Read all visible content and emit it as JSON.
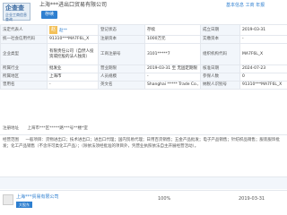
{
  "header": {
    "logo_title": "企查查",
    "logo_sub": "企业工商信息查询",
    "company_name": "上海***进出口贸易有限公司",
    "tag": "存续",
    "right_text": "基本信息 工商 年报"
  },
  "info": {
    "rows": [
      [
        "法定代表人",
        "赵**",
        "登记状态",
        "存续",
        "成立日期",
        "2019-03-31"
      ],
      [
        "统一社会信用代码",
        "91310***MA7F6L_X",
        "注册资本",
        "1000万元",
        "实缴资本",
        "-"
      ],
      [
        "企业类型",
        "有限责任公司（自然人投资或控股的法人独资）",
        "工商注册号",
        "3101*****7",
        "组织机构代码",
        "MA7F6L_X"
      ],
      [
        "所属行业",
        "批发业",
        "营业期限",
        "2019-03-31 至 无固定期限",
        "核准日期",
        "2024-07-23"
      ],
      [
        "所属地区",
        "上海市",
        "人员规模",
        "-",
        "参保人数",
        "0"
      ],
      [
        "曾用名",
        "-",
        "英文名",
        "Shanghai ***** Trade Co., Ltd.",
        "纳税人识别号",
        "91310***MA7F6L_X"
      ]
    ],
    "address_label": "注册地址",
    "address": "上海市***区*****路***号**楼*室"
  },
  "scope": {
    "label": "经营范围",
    "text": "一般项目：货物进出口；技术进出口；进出口代理；国内贸易代理；日用百货销售；五金产品批发；电子产品销售；针纺织品销售；服装服饰批发；化工产品销售（不含许可类化工产品）；（除依法须经批准的项目外，凭营业执照依法自主开展经营活动）。"
  },
  "shareholder": {
    "name": "上海***贸易有限公司",
    "badge": "大股东",
    "percent": "100%",
    "date": "2019-03-31"
  }
}
